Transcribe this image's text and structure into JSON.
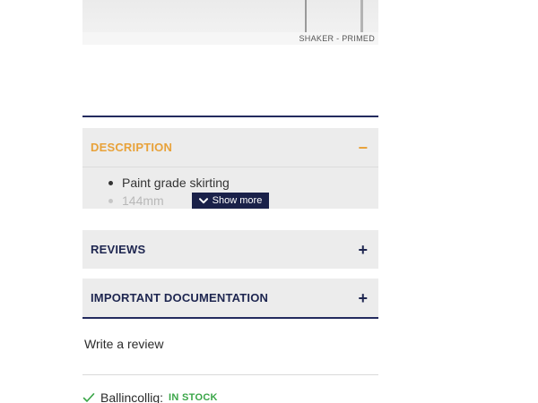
{
  "product_image": {
    "caption": "SHAKER - PRIMED"
  },
  "accordion": {
    "description": {
      "title": "DESCRIPTION",
      "toggle": "−",
      "items": [
        "Paint grade skirting",
        "144mm"
      ],
      "show_more_label": "Show more"
    },
    "reviews": {
      "title": "REVIEWS",
      "toggle": "+"
    },
    "documentation": {
      "title": "IMPORTANT DOCUMENTATION",
      "toggle": "+"
    }
  },
  "write_review_label": "Write a review",
  "stock": {
    "location": "Ballincollig:",
    "status": "IN STOCK"
  },
  "colors": {
    "navy": "#1e2650",
    "accent_orange": "#e8a23a",
    "in_stock_green": "#3aa648",
    "panel_grey": "#ececec"
  },
  "icons": {
    "collapse": "minus-icon",
    "expand": "plus-icon",
    "show_more": "chevron-down-icon",
    "stock": "check-icon"
  }
}
